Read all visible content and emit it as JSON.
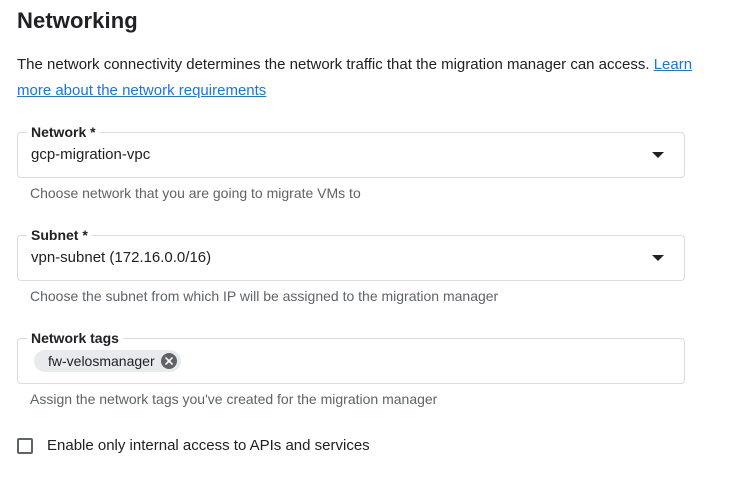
{
  "section": {
    "title": "Networking",
    "description": "The network connectivity determines the network traffic that the migration manager can access.",
    "link_text": "Learn more about the network requirements"
  },
  "network": {
    "label": "Network *",
    "value": "gcp-migration-vpc",
    "hint": "Choose network that you are going to migrate VMs to"
  },
  "subnet": {
    "label": "Subnet *",
    "value": "vpn-subnet (172.16.0.0/16)",
    "hint": "Choose the subnet from which IP will be assigned to the migration manager"
  },
  "network_tags": {
    "label": "Network tags",
    "chips": [
      "fw-velosmanager"
    ],
    "hint": "Assign the network tags you've created for the migration manager"
  },
  "internal_access": {
    "label": "Enable only internal access to APIs and services",
    "checked": false
  },
  "icons": {
    "dropdown": "chevron-down-icon",
    "chip_remove": "close-circle-icon",
    "checkbox": "checkbox-unchecked-icon"
  },
  "colors": {
    "link": "#1a73e8",
    "border": "#dadce0",
    "hint_text": "#5f6368",
    "chip_bg": "#e8eaed"
  }
}
